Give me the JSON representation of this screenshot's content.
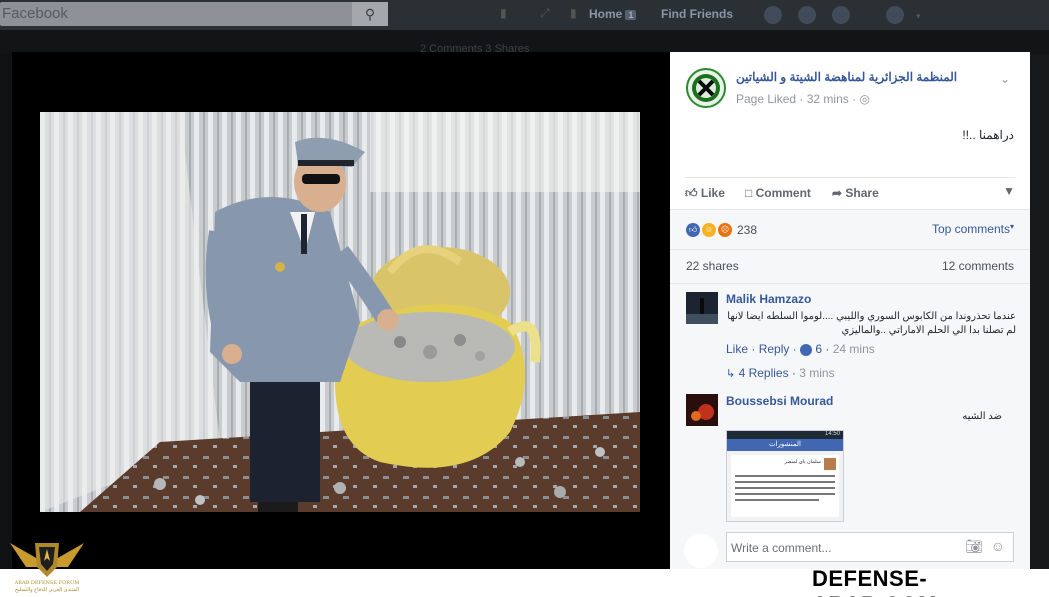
{
  "topbar": {
    "search_placeholder": "Facebook",
    "home_label": "Home",
    "home_badge": "1",
    "find_friends_label": "Find Friends"
  },
  "background_strip": {
    "comments_shares": "2 Comments  3 Shares"
  },
  "post": {
    "page_name": "المنظمة الجزائرية لمناهضة الشيتة و الشياتين",
    "page_status": "Page Liked",
    "time": "32 mins",
    "text": "دراهمنا ..!!",
    "actions": {
      "like": "Like",
      "comment": "Comment",
      "share": "Share"
    },
    "reaction_count": "238",
    "top_comments_label": "Top comments",
    "shares": "22 shares",
    "comments_count": "12 comments"
  },
  "comments": [
    {
      "author": "Malik Hamzazo",
      "text_line1": "عندما تحذروندا من الكابوس السوري والليبي ....لوموا السلطه ايضا لانها",
      "text_line2": "لم تصلنا بدا الي الحلم الاماراتي ..والماليزي",
      "like": "Like",
      "reply": "Reply",
      "likes": "6",
      "time": "24 mins",
      "replies": "4 Replies",
      "replies_time": "3 mins"
    },
    {
      "author": "Boussebsi Mourad",
      "text": "ضد الشيه",
      "screenshot_header": "المنشورات",
      "screenshot_time": "14:50",
      "screenshot_name": "سلمان ياي لمنضر"
    }
  ],
  "write_comment_placeholder": "Write a comment...",
  "watermark": {
    "text": "DEFENSE-ARAB.COM",
    "logo_line1": "ARAB DEFENSE FORUM",
    "logo_line2": "المنتدى العربي للدفاع والتسليح"
  },
  "colors": {
    "facebook_blue": "#365899",
    "like_blue": "#4267b2",
    "overlay": "#111213"
  }
}
